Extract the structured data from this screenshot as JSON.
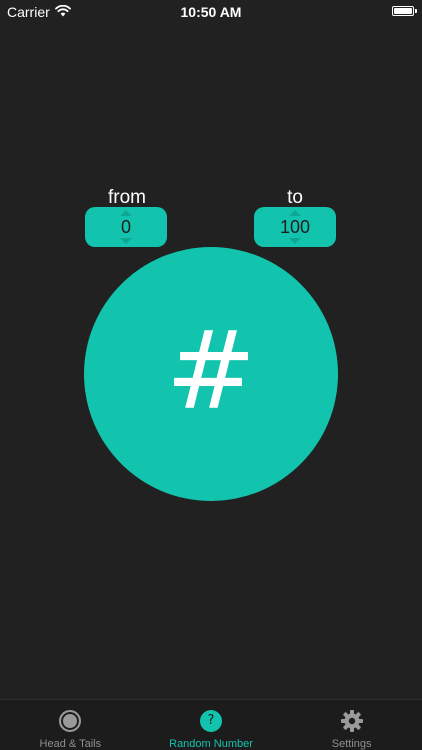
{
  "status_bar": {
    "carrier": "Carrier",
    "time": "10:50 AM"
  },
  "range": {
    "from_label": "from",
    "from_value": "0",
    "to_label": "to",
    "to_value": "100"
  },
  "main": {
    "symbol": "#"
  },
  "tabs": [
    {
      "label": "Head & Tails",
      "icon": "coin-icon",
      "active": false
    },
    {
      "label": "Random Number",
      "icon": "question-icon",
      "active": true,
      "icon_text": "?"
    },
    {
      "label": "Settings",
      "icon": "gear-icon",
      "active": false
    }
  ],
  "colors": {
    "accent": "#12c4ad",
    "background": "#212121",
    "tab_inactive": "#8f8f8f"
  }
}
